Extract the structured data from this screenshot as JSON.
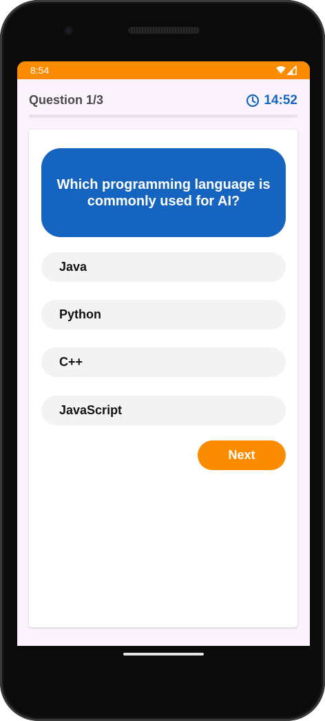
{
  "status_bar": {
    "time": "8:54",
    "icons": [
      "wifi-icon",
      "signal-icon"
    ],
    "color": "#fb8c00"
  },
  "header": {
    "question_counter": "Question 1/3",
    "timer_icon": "clock-icon",
    "timer": "14:52"
  },
  "progress": {
    "fraction": 0
  },
  "question": {
    "text": "Which programming language is commonly used for AI?"
  },
  "options": [
    {
      "label": "Java"
    },
    {
      "label": "Python"
    },
    {
      "label": "C++"
    },
    {
      "label": "JavaScript"
    }
  ],
  "actions": {
    "next_label": "Next"
  },
  "colors": {
    "accent": "#fb8c00",
    "question_bg": "#1565c0",
    "timer": "#1565c0",
    "option_bg": "#f3f3f3"
  }
}
